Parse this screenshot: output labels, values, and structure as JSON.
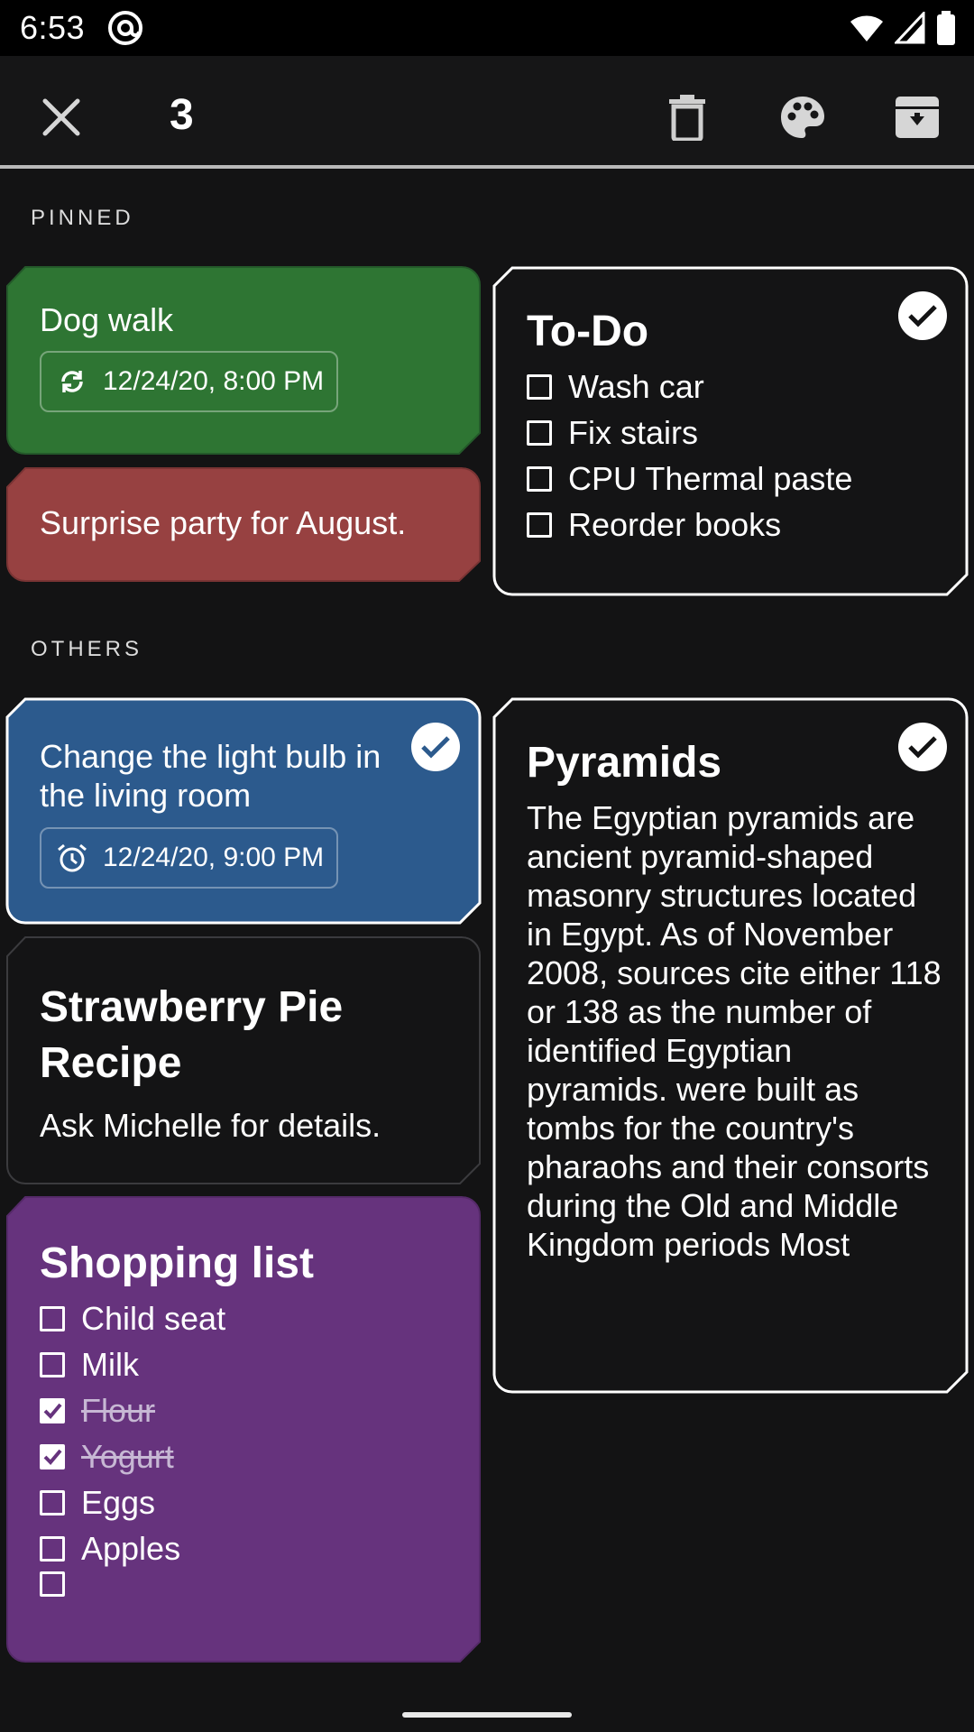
{
  "status_bar": {
    "time": "6:53"
  },
  "action_bar": {
    "selected_count": "3"
  },
  "sections": {
    "pinned": "PINNED",
    "others": "OTHERS"
  },
  "colors": {
    "green": "#2e7533",
    "red": "#974141",
    "blue": "#2c5a8d",
    "purple": "#66337d",
    "dark": "#131314"
  },
  "icons": {
    "close": "close-icon",
    "delete": "trash-icon",
    "color": "palette-icon",
    "archive": "archive-icon",
    "repeat": "repeat-icon",
    "alarm": "alarm-icon",
    "selected": "check-circle-icon"
  },
  "notes": {
    "dog_walk": {
      "title": "Dog walk",
      "reminder": "12/24/20, 8:00 PM"
    },
    "surprise": {
      "body": "Surprise party for August."
    },
    "todo": {
      "title": "To-Do",
      "items": [
        {
          "label": "Wash car",
          "checked": false
        },
        {
          "label": "Fix stairs",
          "checked": false
        },
        {
          "label": "CPU Thermal paste",
          "checked": false
        },
        {
          "label": "Reorder books",
          "checked": false
        }
      ]
    },
    "light_bulb": {
      "title": "Change the light bulb in the living room",
      "reminder": "12/24/20, 9:00 PM"
    },
    "pyramids": {
      "title": "Pyramids",
      "body": "The Egyptian pyramids are ancient pyramid-shaped masonry structures located in Egypt. As of November 2008, sources cite either 118 or 138 as the number of identified Egyptian pyramids. were built as tombs for the country's pharaohs and their consorts during the Old and Middle Kingdom periods Most"
    },
    "strawberry": {
      "title": "Strawberry Pie Recipe",
      "body": "Ask Michelle for details."
    },
    "shopping": {
      "title": "Shopping list",
      "items": [
        {
          "label": "Child seat",
          "checked": false
        },
        {
          "label": "Milk",
          "checked": false
        },
        {
          "label": "Flour",
          "checked": true
        },
        {
          "label": "Yogurt",
          "checked": true
        },
        {
          "label": "Eggs",
          "checked": false
        },
        {
          "label": "Apples",
          "checked": false
        },
        {
          "label": "",
          "checked": false
        }
      ]
    }
  }
}
